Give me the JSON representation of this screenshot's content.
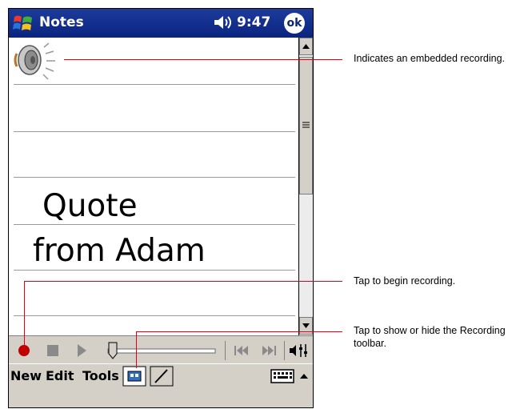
{
  "titlebar": {
    "app_title": "Notes",
    "time": "9:47",
    "ok_label": "ok"
  },
  "note": {
    "line1": "Quote",
    "line2": "from Adam"
  },
  "menubar": {
    "new": "New",
    "edit": "Edit",
    "tools": "Tools"
  },
  "callouts": {
    "embedded": "Indicates an embedded recording.",
    "record": "Tap to begin recording.",
    "toolbar_line1": "Tap to show or hide the Recording",
    "toolbar_line2": "toolbar."
  },
  "colors": {
    "titlebar": "#0a2480",
    "callout": "#e0001b",
    "record_dot": "#c00000"
  }
}
